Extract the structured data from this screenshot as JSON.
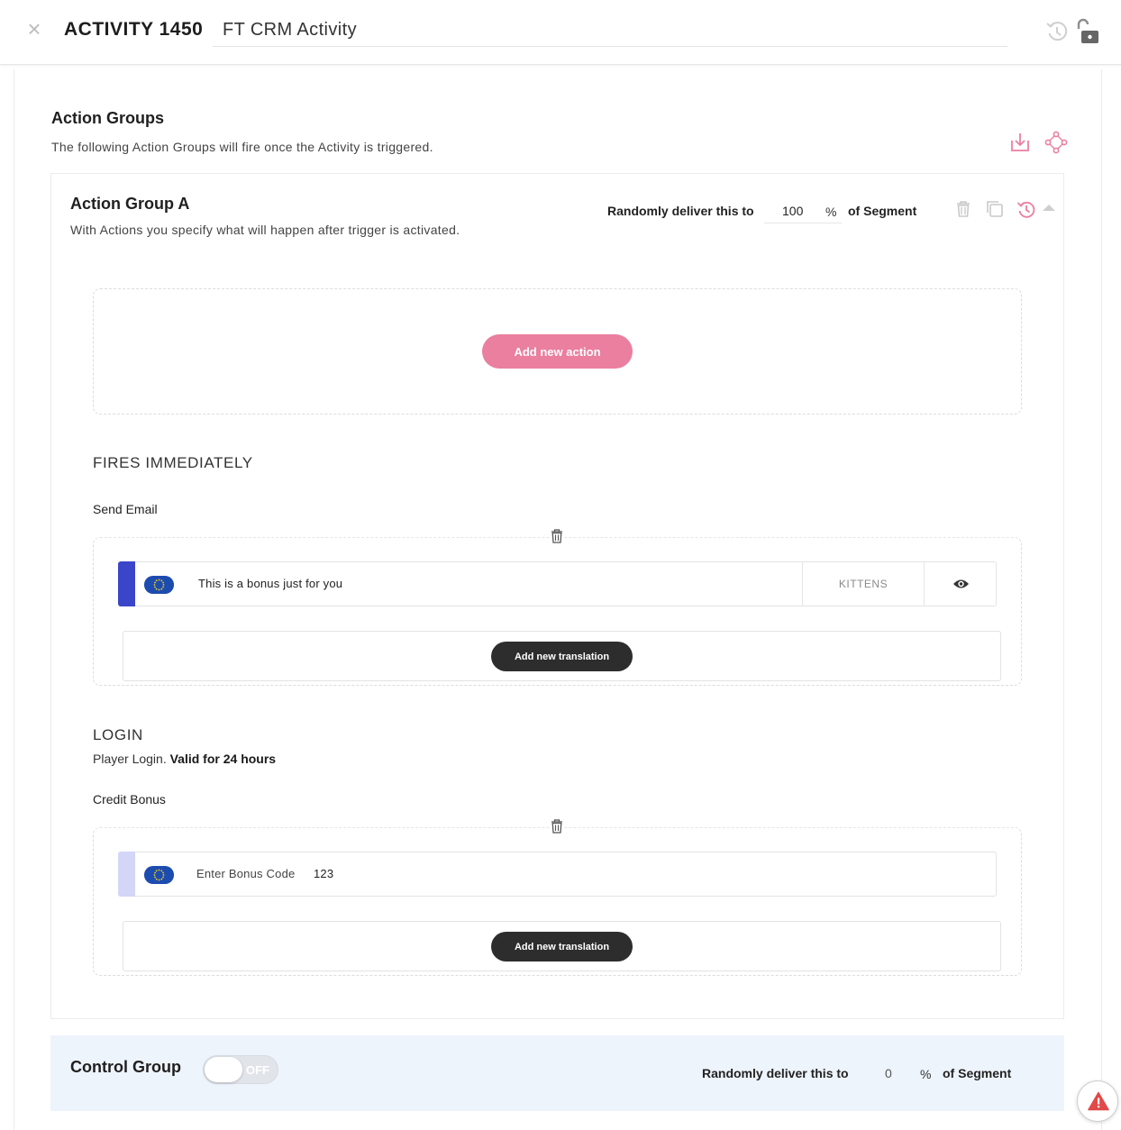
{
  "header": {
    "close_glyph": "×",
    "activity_id": "ACTIVITY 1450",
    "activity_name": "FT CRM Activity",
    "icons": [
      "history-icon",
      "unlock-icon"
    ]
  },
  "action_groups": {
    "title": "Action Groups",
    "description": "The following Action Groups will fire once the Activity is triggered.",
    "icons": [
      "download-icon",
      "flow-diagram-icon"
    ]
  },
  "group_a": {
    "title": "Action Group A",
    "description": "With Actions you specify what will happen after trigger is activated.",
    "deliver_prefix": "Randomly deliver this to",
    "deliver_value": "100",
    "percent_sign": "%",
    "deliver_suffix": "of Segment",
    "icons": [
      "trash-icon",
      "copy-icon",
      "history-icon",
      "chevron-up-icon"
    ],
    "add_action_label": "Add new action",
    "fires_heading": "FIRES IMMEDIATELY",
    "send_email": {
      "name": "Send Email",
      "row_text": "This is a bonus just for you",
      "tag": "KITTENS",
      "add_translation_label": "Add new translation",
      "accent_color": "#3b45c9"
    },
    "login": {
      "heading": "LOGIN",
      "desc_prefix": "Player Login.",
      "desc_bold": "Valid for 24 hours"
    },
    "credit_bonus": {
      "name": "Credit Bonus",
      "field_label": "Enter Bonus Code",
      "field_value": "123",
      "add_translation_label": "Add new translation",
      "accent_color": "#d4d6f7"
    }
  },
  "control_group": {
    "title": "Control Group",
    "toggle_label": "OFF",
    "deliver_prefix": "Randomly deliver this to",
    "deliver_value": "0",
    "percent_sign": "%",
    "deliver_suffix": "of Segment"
  },
  "colors": {
    "pink_accent": "#ea7f9f",
    "dark_button": "#2d2d2d",
    "control_bg": "#eef4fc",
    "warning": "#e04a4a"
  }
}
